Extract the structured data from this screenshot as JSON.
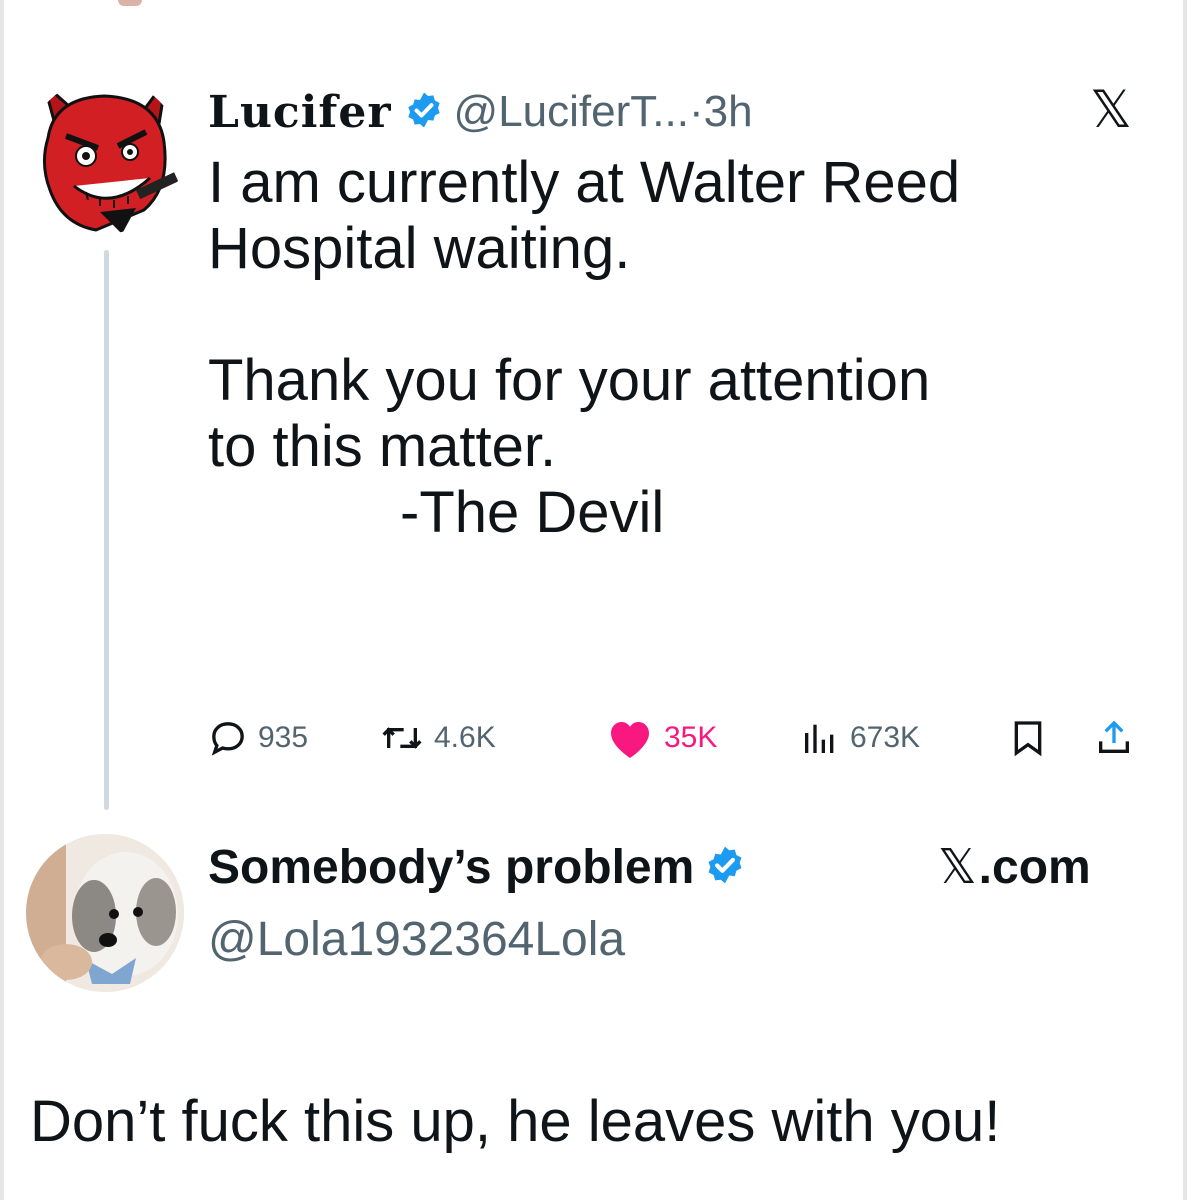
{
  "tweet1": {
    "display_name": "Lucifer",
    "verified": true,
    "handle": "@LuciferT...",
    "separator": "·",
    "time": "3h",
    "platform_icon": "x-logo-icon",
    "body": {
      "line1": "I am currently at Walter Reed",
      "line2": "Hospital waiting.",
      "line3": "Thank you for your attention",
      "line4": "to this matter.",
      "signature": "-The Devil"
    },
    "actions": {
      "replies": "935",
      "reposts": "4.6K",
      "likes": "35K",
      "views": "673K"
    },
    "icons": {
      "reply": "reply-bubble-icon",
      "repost": "repost-icon",
      "like": "heart-icon",
      "views": "views-chart-icon",
      "bookmark": "bookmark-icon",
      "share": "share-icon"
    },
    "like_color": "#f91880"
  },
  "tweet2": {
    "display_name": "Somebody’s problem",
    "verified": true,
    "source_label": ".com",
    "source_icon": "x-logo-icon",
    "handle": "@Lola1932364Lola",
    "text": "Don’t fuck this up, he leaves with you!"
  },
  "colors": {
    "verified_blue": "#1d9bf0",
    "secondary_text": "#536471",
    "primary_text": "#0f1419"
  }
}
